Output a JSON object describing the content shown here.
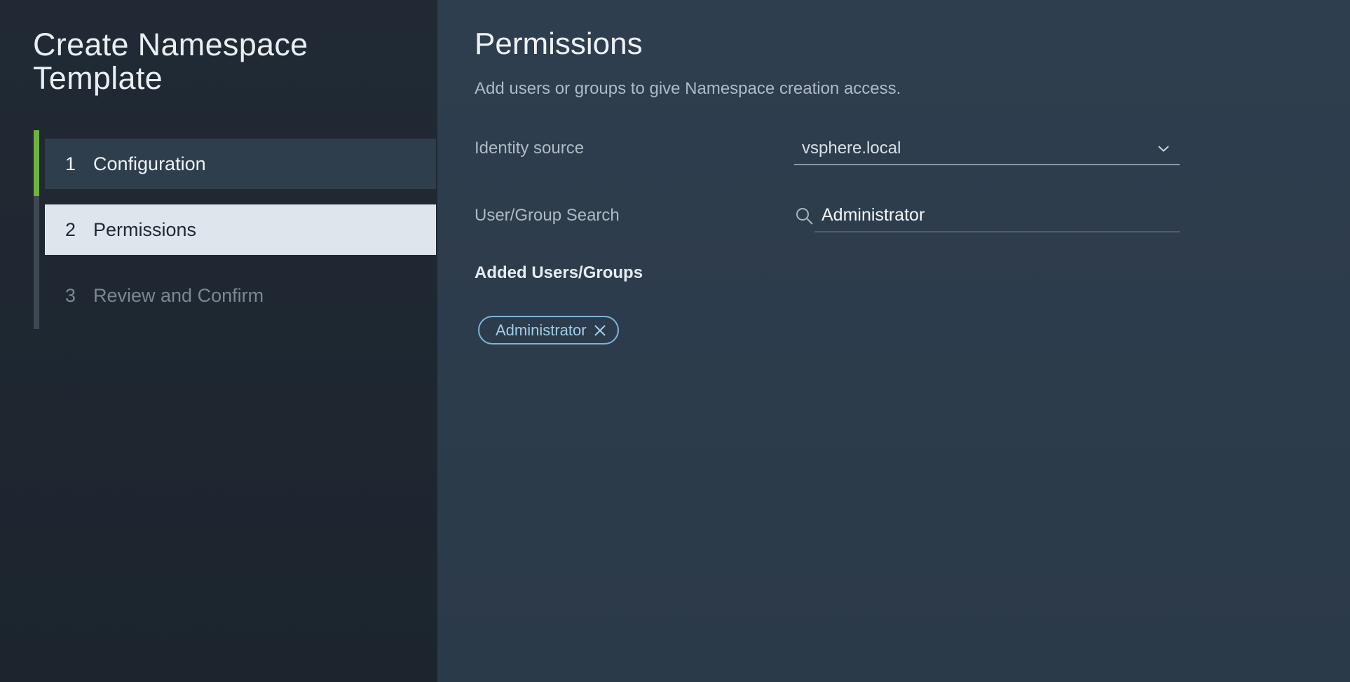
{
  "wizard": {
    "title": "Create Namespace Template",
    "steps": [
      {
        "number": "1",
        "label": "Configuration",
        "state": "completed"
      },
      {
        "number": "2",
        "label": "Permissions",
        "state": "active"
      },
      {
        "number": "3",
        "label": "Review and Confirm",
        "state": "pending"
      }
    ]
  },
  "main": {
    "title": "Permissions",
    "subtitle": "Add users or groups to give Namespace creation access.",
    "identity_source": {
      "label": "Identity source",
      "value": "vsphere.local"
    },
    "user_group_search": {
      "label": "User/Group Search",
      "value": "Administrator"
    },
    "added": {
      "heading": "Added Users/Groups",
      "tags": [
        "Administrator"
      ]
    }
  },
  "colors": {
    "sidebar_bg": "#1f2831",
    "main_bg": "#2d3c4b",
    "progress_accent": "#6fb33f",
    "active_step_bg": "#dfe5ec",
    "tag_border": "#7fb4d6"
  },
  "icons": [
    "search-icon",
    "chevron-down-icon",
    "close-icon"
  ]
}
